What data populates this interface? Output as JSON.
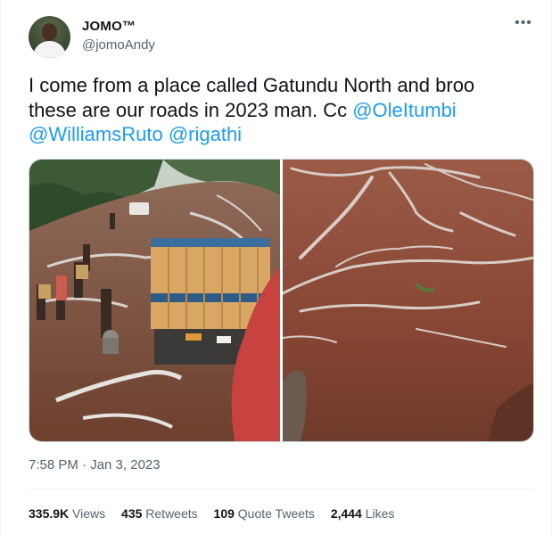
{
  "author": {
    "display_name": "JOMO™",
    "handle": "@jomoAndy"
  },
  "more_icon": "more-horizontal-icon",
  "tweet": {
    "text_before": "I come from a place called Gatundu North and broo these are our roads in 2023 man. Cc ",
    "mentions": [
      "@OleItumbi",
      "@WilliamsRuto",
      "@rigathi"
    ]
  },
  "media": {
    "photos": [
      "muddy-road-with-truck",
      "muddy-road-close-up"
    ]
  },
  "timestamp": "7:58 PM · Jan 3, 2023",
  "stats": {
    "views_count": "335.9K",
    "views_label": "Views",
    "retweets_count": "435",
    "retweets_label": "Retweets",
    "quotes_count": "109",
    "quotes_label": "Quote Tweets",
    "likes_count": "2,444",
    "likes_label": "Likes"
  },
  "colors": {
    "link": "#1d9bf0",
    "secondary_text": "#536471",
    "primary_text": "#0f1419"
  }
}
